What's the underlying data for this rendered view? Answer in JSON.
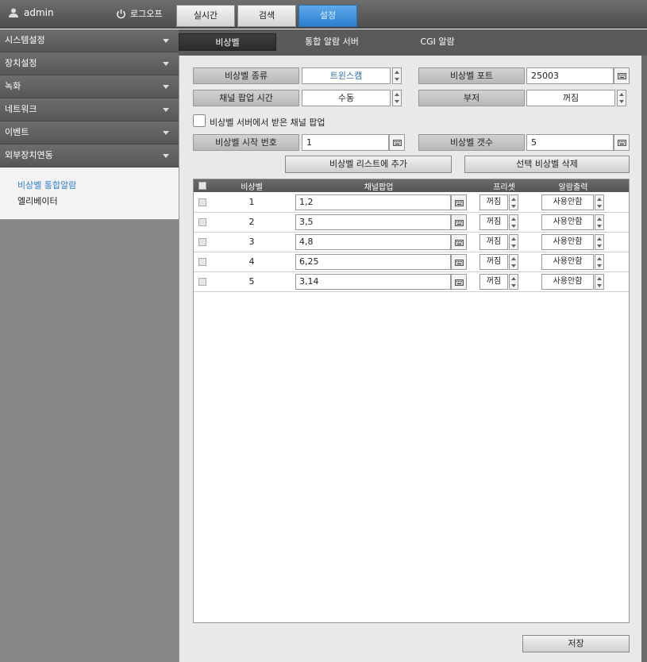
{
  "topbar": {
    "username": "admin",
    "logout_label": "로그오프",
    "tabs": [
      "실시간",
      "검색",
      "설정"
    ]
  },
  "sidebar": {
    "items": [
      "시스템설정",
      "장치설정",
      "녹화",
      "네트워크",
      "이벤트",
      "외부장치연동"
    ],
    "subitems": [
      "비상벨 통합알람",
      "엘리베이터"
    ]
  },
  "subtabs": [
    "비상벨",
    "통합 알람 서버",
    "CGI 알람"
  ],
  "form": {
    "bell_type_label": "비상벨 종류",
    "bell_type_value": "트윈스캠",
    "bell_port_label": "비상벨 포트",
    "bell_port_value": "25003",
    "popup_time_label": "채널 팝업 시간",
    "popup_time_value": "수동",
    "buzzer_label": "부저",
    "buzzer_value": "꺼짐",
    "server_popup_label": "비상벨 서버에서 받은 채널 팝업",
    "start_no_label": "비상벨 시작 번호",
    "start_no_value": "1",
    "count_label": "비상벨 갯수",
    "count_value": "5",
    "add_button": "비상벨 리스트에 추가",
    "delete_button": "선택 비상벨 삭제"
  },
  "table": {
    "headers": [
      "비상벨",
      "채널팝업",
      "프리셋",
      "알람출력"
    ],
    "rows": [
      {
        "bell": "1",
        "channel": "1,2",
        "preset": "꺼짐",
        "alarm": "사용안함"
      },
      {
        "bell": "2",
        "channel": "3,5",
        "preset": "꺼짐",
        "alarm": "사용안함"
      },
      {
        "bell": "3",
        "channel": "4,8",
        "preset": "꺼짐",
        "alarm": "사용안함"
      },
      {
        "bell": "4",
        "channel": "6,25",
        "preset": "꺼짐",
        "alarm": "사용안함"
      },
      {
        "bell": "5",
        "channel": "3,14",
        "preset": "꺼짐",
        "alarm": "사용안함"
      }
    ]
  },
  "save_label": "저장",
  "colors": {
    "accent": "#2a7fcf",
    "selected_text": "#2f7fd0"
  }
}
